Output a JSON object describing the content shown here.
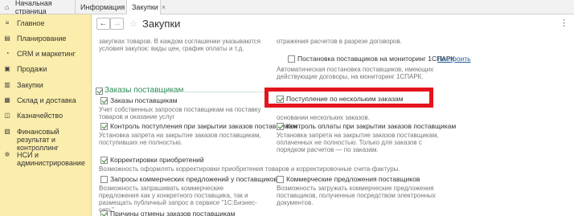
{
  "tabs": {
    "home": "Начальная страница",
    "info": "Информация",
    "purchases": "Закупки"
  },
  "sidebar": {
    "items": [
      {
        "label": "Главное",
        "icon": "menu-icon"
      },
      {
        "label": "Планирование",
        "icon": "planning-icon"
      },
      {
        "label": "CRM и маркетинг",
        "icon": "crm-icon"
      },
      {
        "label": "Продажи",
        "icon": "sales-icon"
      },
      {
        "label": "Закупки",
        "icon": "purchases-icon"
      },
      {
        "label": "Склад и доставка",
        "icon": "warehouse-icon"
      },
      {
        "label": "Казначейство",
        "icon": "treasury-icon"
      },
      {
        "label": "Финансовый результат и контроллинг",
        "icon": "finance-icon"
      },
      {
        "label": "НСИ и администрирование",
        "icon": "gear-icon"
      }
    ]
  },
  "header": {
    "title": "Закупки",
    "back": "←",
    "forward": "→",
    "star": "☆",
    "more": "⋮"
  },
  "content": {
    "top_left_desc": "закупках товаров. В каждом соглашении указываются условия закупок: виды цен, график оплаты и т.д.",
    "top_right_desc": "отражения расчетов в разрезе договоров.",
    "monitoring_label": "Постановка поставщиков на мониторинг 1СПАРК",
    "monitoring_link": "Настроить",
    "monitoring_desc": "Автоматическая постановка поставщиков, имеющих действующие договоры, на мониторинг 1СПАРК.",
    "section_title": "Заказы поставщикам",
    "supplier_orders_label": "Заказы поставщикам",
    "supplier_orders_desc": "Учет собственных запросов поставщикам на поставку товаров и оказание услуг",
    "multi_orders_label": "Поступление по нескольким заказам",
    "multi_orders_desc": "основании нескольких заказов.",
    "receipt_control_label": "Контроль поступления при закрытии заказов поставщикам",
    "receipt_control_desc": "Установка запрета на закрытие заказов поставщикам, поступивших не полностью.",
    "payment_control_label": "Контроль оплаты при закрытии заказов поставщикам",
    "payment_control_desc": "Установка запрета на закрытие заказов поставщикам, оплаченных не полностью. Только для заказов с порядком расчетов — по заказам.",
    "corrections_label": "Корректировки приобретений",
    "corrections_desc": "Возможность оформлять корректировки приобретения товаров и корректировочные счета-фактуры.",
    "rfq_label": "Запросы коммерческих предложений у поставщиков",
    "rfq_desc": "Возможность запрашивать коммерческие предложения как у конкретного поставщика, так и размещать публичный запрос в сервисе \"1С:Бизнес-сеть\"",
    "offers_label": "Коммерческие предложения поставщиков",
    "offers_desc": "Возможность загружать коммерческие предложения поставщиков, полученные посредством электронных документов.",
    "cancel_reasons_label": "Причины отмены заказов поставщикам"
  },
  "colors": {
    "sidebar_bg": "#fbedab",
    "section_green": "#2e8b57",
    "highlight_red": "#e4141c",
    "link_blue": "#1b5a9e"
  }
}
